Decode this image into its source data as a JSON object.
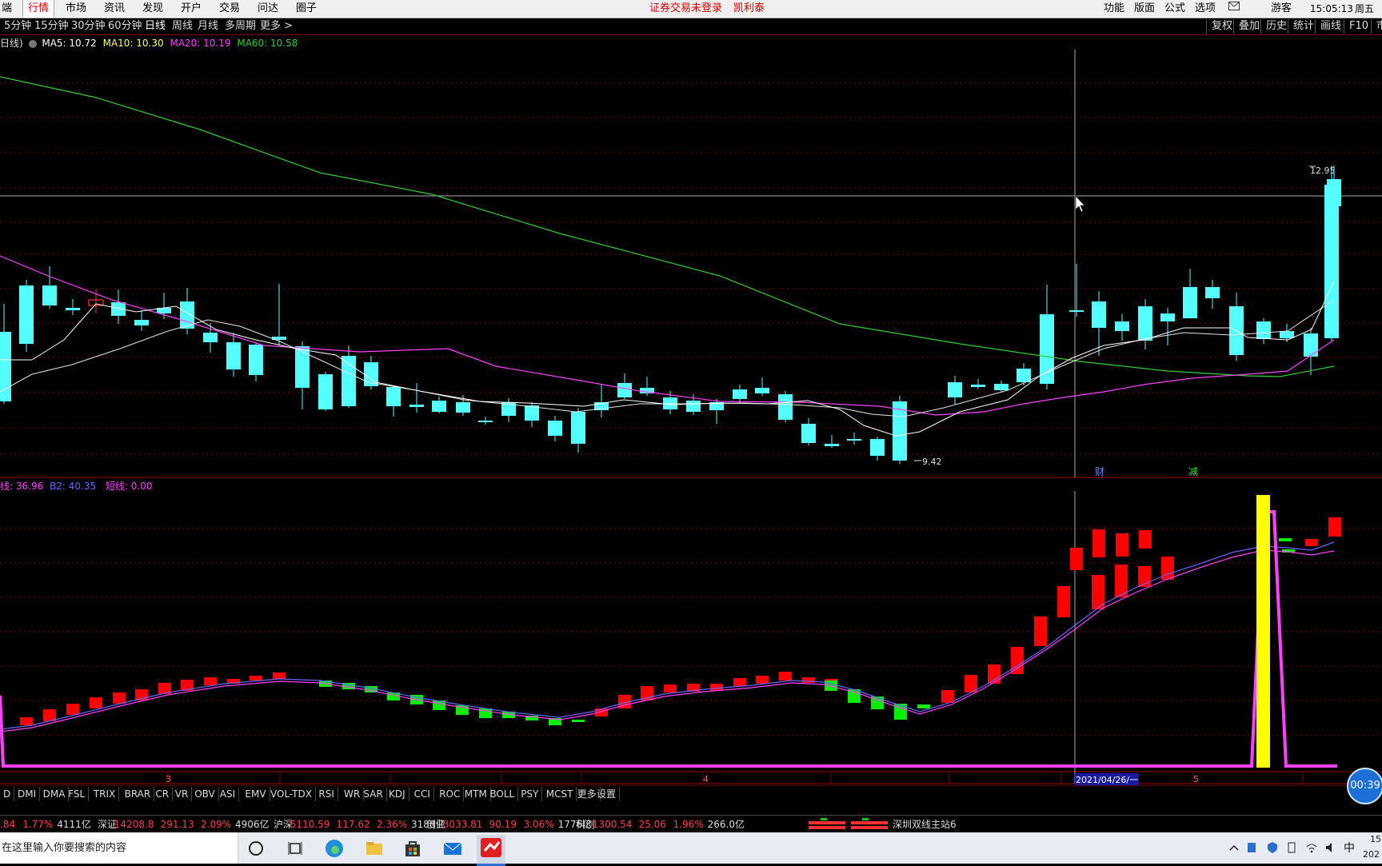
{
  "menu": {
    "items": [
      "端",
      "行情",
      "市场",
      "资讯",
      "发现",
      "开户",
      "交易",
      "问达",
      "圈子"
    ],
    "active": "行情",
    "warning": "证券交易未登录",
    "broker": "凯利泰",
    "right_items": [
      "功能",
      "版面",
      "公式",
      "选项"
    ],
    "mail_icon": "mail-icon",
    "guest": "游客",
    "time": "15:05:13",
    "weekday": "周五"
  },
  "period_bar": {
    "items": [
      "5分钟",
      "15分钟",
      "30分钟",
      "60分钟",
      "日线",
      "周线",
      "月线",
      "多周期",
      "更多 >"
    ],
    "active": "日线",
    "right_buttons": [
      "复权",
      "叠加",
      "历史",
      "统计",
      "画线",
      "F10",
      "市"
    ]
  },
  "main_chart": {
    "legend_prefix": "日线)",
    "ma5": "MA5: 10.72",
    "ma10": "MA10: 10.30",
    "ma20": "MA20: 10.19",
    "ma60": "MA60: 10.58",
    "high_label": "12.95",
    "low_label": "9.42",
    "marker_cai": "财",
    "marker_jian": "减",
    "colors": {
      "up": "#ff3232",
      "down": "#54ffff",
      "ma5": "#ffffff",
      "ma10": "#ffff66",
      "ma20": "#ff40ff",
      "ma60": "#33cc33"
    }
  },
  "sub_chart": {
    "legend": [
      "线: 36.96",
      "B2: 40.35",
      "短线: 0.00"
    ],
    "colors": {
      "up": "#ff0000",
      "down": "#00ee00",
      "line1": "#6666ff",
      "line2": "#ff40ff",
      "spike": "#ffff00"
    }
  },
  "date_axis": [
    "3",
    "4",
    "2021/04/26/一",
    "5"
  ],
  "indicator_tabs": [
    "D",
    "DMI",
    "DMA",
    "FSL",
    "TRIX",
    "BRAR",
    "CR",
    "VR",
    "OBV",
    "ASI",
    "EMV",
    "VOL-TDX",
    "RSI",
    "WR",
    "SAR",
    "KDJ",
    "CCI",
    "ROC",
    "MTM",
    "BOLL",
    "PSY",
    "MCST",
    "更多",
    "设置"
  ],
  "ticker": {
    "items": [
      {
        "name": "",
        "value": ".84",
        "change": "1.77%",
        "amount": "4111亿"
      },
      {
        "name": "深证",
        "value": "14208.8",
        "diff": "291.13",
        "change": "2.09%",
        "amount": "4906亿"
      },
      {
        "name": "沪深",
        "value": "5110.59",
        "diff": "117.62",
        "change": "2.36%",
        "amount": "3188亿"
      },
      {
        "name": "创业",
        "value": "3033.81",
        "diff": "90.19",
        "change": "3.06%",
        "amount": "1776亿"
      },
      {
        "name": "科创",
        "value": "1300.54",
        "diff": "25.06",
        "change": "1.96%",
        "amount": "266.0亿"
      }
    ],
    "station": "深圳双线主站6"
  },
  "taskbar": {
    "search_placeholder": "在这里输入你要搜索的内容",
    "ime": "中",
    "clock_top": "15",
    "clock_bottom": "202"
  },
  "video_timer": "00:39"
}
